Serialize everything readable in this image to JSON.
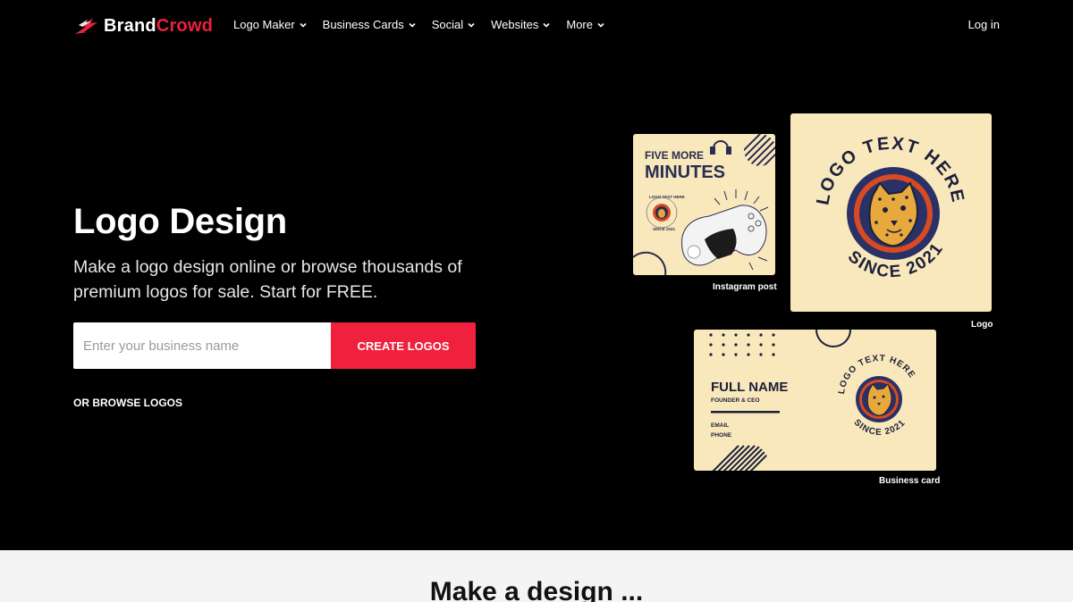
{
  "brand": {
    "name_part1": "Brand",
    "name_part2": "Crowd",
    "accent": "#e8213d"
  },
  "nav": {
    "items": [
      {
        "label": "Logo Maker"
      },
      {
        "label": "Business Cards"
      },
      {
        "label": "Social"
      },
      {
        "label": "Websites"
      },
      {
        "label": "More"
      }
    ],
    "login": "Log in"
  },
  "hero": {
    "title": "Logo Design",
    "subtitle": "Make a logo design online or browse thousands of premium logos for sale. Start for FREE.",
    "search_placeholder": "Enter your business name",
    "cta": "CREATE LOGOS",
    "browse": "OR BROWSE LOGOS",
    "cta_color": "#f0213d"
  },
  "cards": {
    "instagram": {
      "caption": "Instagram post",
      "line1": "FIVE MORE",
      "line2": "MINUTES",
      "badge_top": "LOGO TEXT HERE",
      "badge_bottom": "SINCE 2021"
    },
    "logo": {
      "caption": "Logo",
      "arc_top": "LOGO TEXT HERE",
      "arc_bottom": "SINCE 2021"
    },
    "business": {
      "caption": "Business card",
      "name": "FULL NAME",
      "role": "FOUNDER & CEO",
      "email": "EMAIL",
      "phone": "PHONE",
      "arc_top": "LOGO TEXT HERE",
      "arc_bottom": "SINCE 2021"
    }
  },
  "bottom": {
    "title": "Make a design ..."
  }
}
